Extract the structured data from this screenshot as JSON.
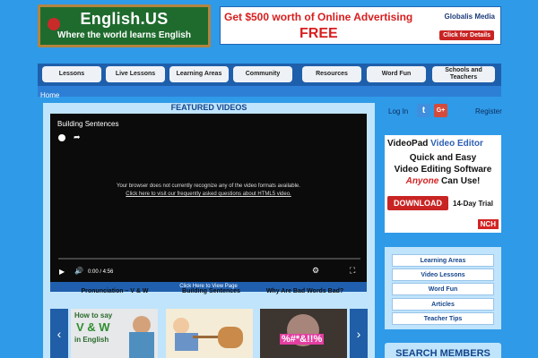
{
  "logo": {
    "title": "English.US",
    "tagline": "Where the world learns English"
  },
  "banner": {
    "line1": "Get $500 worth of Online Advertising",
    "line2": "FREE",
    "brand": "Globalis Media",
    "cta": "Click for Details"
  },
  "nav": {
    "items": [
      {
        "label": "Lessons"
      },
      {
        "label": "Live Lessons"
      },
      {
        "label": "Learning Areas"
      },
      {
        "label": "Community"
      },
      {
        "label": "Resources"
      },
      {
        "label": "Word Fun"
      },
      {
        "label": "Schools and Teachers"
      }
    ]
  },
  "breadcrumb": {
    "home": "Home"
  },
  "featured": {
    "heading": "FEATURED VIDEOS",
    "video_title": "Building Sentences",
    "error_line1": "Your browser does not currently recognize any of the video formats available.",
    "error_line2": "Click here to visit our frequently asked questions about HTML5 video.",
    "time": "0:00 / 4:56",
    "progress": 0,
    "view_page": "Click Here to View Page",
    "columns": [
      {
        "label": "Pronunciation – V & W"
      },
      {
        "label": "Building Sentences"
      },
      {
        "label": "Why Are Bad Words Bad?"
      }
    ],
    "thumb1_text": [
      "How to say",
      "V & W",
      "in English"
    ],
    "thumb3_text": "%#*&!!%"
  },
  "sidebar": {
    "login": "Log In",
    "twitter": "t",
    "gplus": "G+",
    "register": "Register",
    "ad": {
      "brand": "VideoPad",
      "product": "Video Editor",
      "line1": "Quick and Easy",
      "line2": "Video Editing Software",
      "anyone": "Anyone",
      "line3_rest": "Can Use!",
      "download": "DOWNLOAD",
      "trial": "14-Day Trial",
      "maker": "NCH"
    },
    "menu": [
      {
        "label": "Learning Areas"
      },
      {
        "label": "Video Lessons"
      },
      {
        "label": "Word Fun"
      },
      {
        "label": "Articles"
      },
      {
        "label": "Teacher Tips"
      }
    ],
    "search_heading": "SEARCH MEMBERS"
  }
}
